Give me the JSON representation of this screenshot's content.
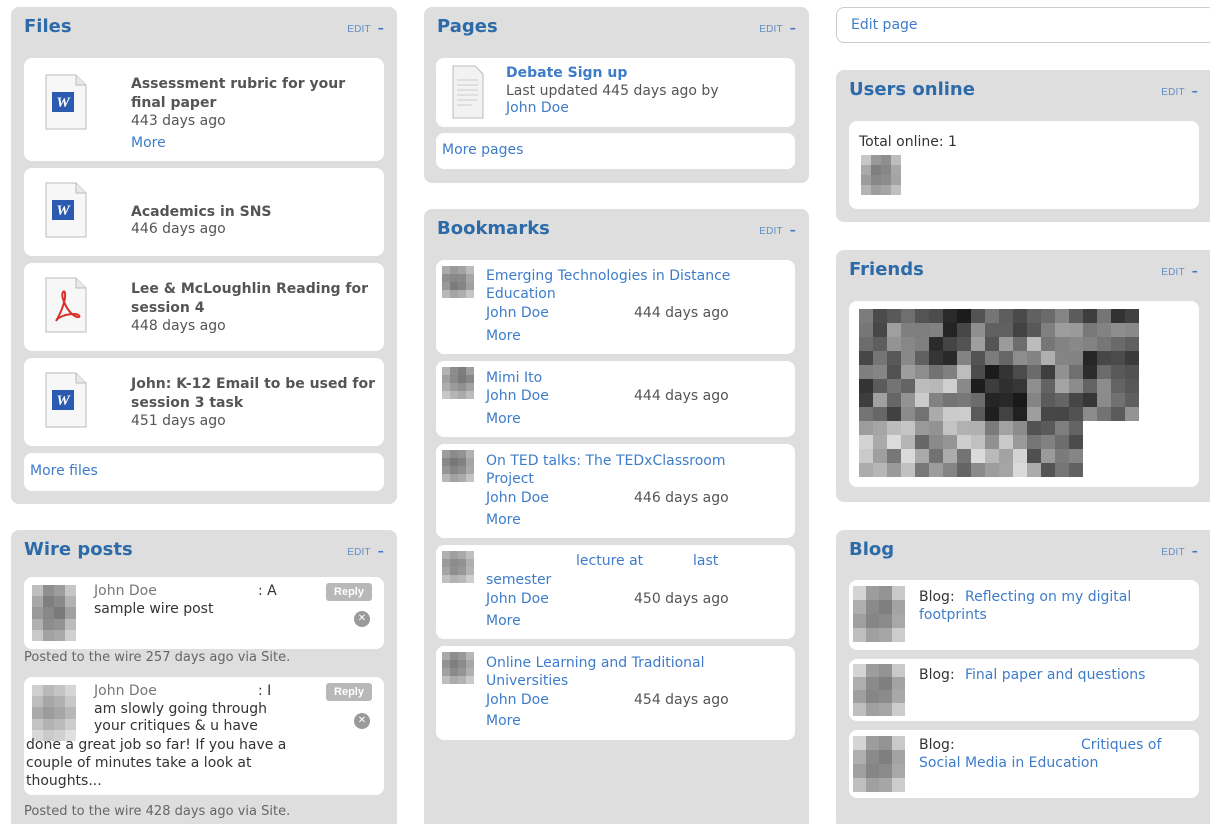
{
  "files": {
    "title": "Files",
    "edit": "EDIT",
    "items": [
      {
        "title": "Assessment rubric for your final paper",
        "date": "443 days ago",
        "more": "More",
        "icon": "word-document-icon"
      },
      {
        "title": "Academics in SNS",
        "date": "446 days ago",
        "icon": "word-document-icon"
      },
      {
        "title": "Lee & McLoughlin Reading for session 4",
        "date": "448 days ago",
        "icon": "pdf-document-icon"
      },
      {
        "title": "John: K-12 Email to be used for session 3 task",
        "date": "451 days ago",
        "icon": "word-document-icon"
      }
    ],
    "more_files": "More files"
  },
  "wire": {
    "title": "Wire posts",
    "edit": "EDIT",
    "posts": [
      {
        "author": "John Doe",
        "colon": ": A",
        "text": "sample wire post",
        "reply": "Reply",
        "footer": "Posted to the wire 257 days ago via Site."
      },
      {
        "author": "John Doe",
        "colon": ": I",
        "text1": "am slowly going through",
        "text2": "your critiques & u have",
        "text3": "done a great job so far! If you have a",
        "text4": "couple of minutes take a look at",
        "text5": "thoughts...",
        "reply": "Reply",
        "footer": "Posted to the wire 428 days ago via Site."
      }
    ]
  },
  "pages": {
    "title": "Pages",
    "edit": "EDIT",
    "item": {
      "title": "Debate Sign up",
      "updated": "Last updated 445 days ago by",
      "author": "John Doe"
    },
    "more": "More pages"
  },
  "bookmarks": {
    "title": "Bookmarks",
    "edit": "EDIT",
    "items": [
      {
        "title1": "Emerging Technologies in Distance",
        "title2": "Education",
        "author": "John Doe",
        "date": "444 days ago",
        "more": "More"
      },
      {
        "title1": "Mimi Ito",
        "title2": "",
        "author": "John Doe",
        "date": "444 days ago",
        "more": "More"
      },
      {
        "title1": "On TED talks: The TEDxClassroom",
        "title2": "Project",
        "author": "John Doe",
        "date": "446 days ago",
        "more": "More"
      },
      {
        "title1a": "lecture at",
        "title1b": "last",
        "title2": "semester",
        "author": "John Doe",
        "date": "450 days ago",
        "more": "More"
      },
      {
        "title1": "Online Learning and Traditional",
        "title2": "Universities",
        "author": "John Doe",
        "date": "454 days ago",
        "more": "More"
      }
    ]
  },
  "editpage": {
    "label": "Edit page"
  },
  "users": {
    "title": "Users online",
    "edit": "EDIT",
    "total": "Total online: 1"
  },
  "friends": {
    "title": "Friends",
    "edit": "EDIT"
  },
  "blog": {
    "title": "Blog",
    "edit": "EDIT",
    "items": [
      {
        "prefix": "Blog:",
        "line1": "Reflecting on my digital",
        "line2": "footprints"
      },
      {
        "prefix": "Blog:",
        "line1": "Final paper and questions",
        "line2": ""
      },
      {
        "prefix": "Blog:",
        "line1": "Critiques of",
        "line2": "Social Media in Education"
      }
    ]
  },
  "colors": {
    "panel": "#dedede",
    "heading": "#2d6aa8",
    "link": "#3e7cc9"
  }
}
